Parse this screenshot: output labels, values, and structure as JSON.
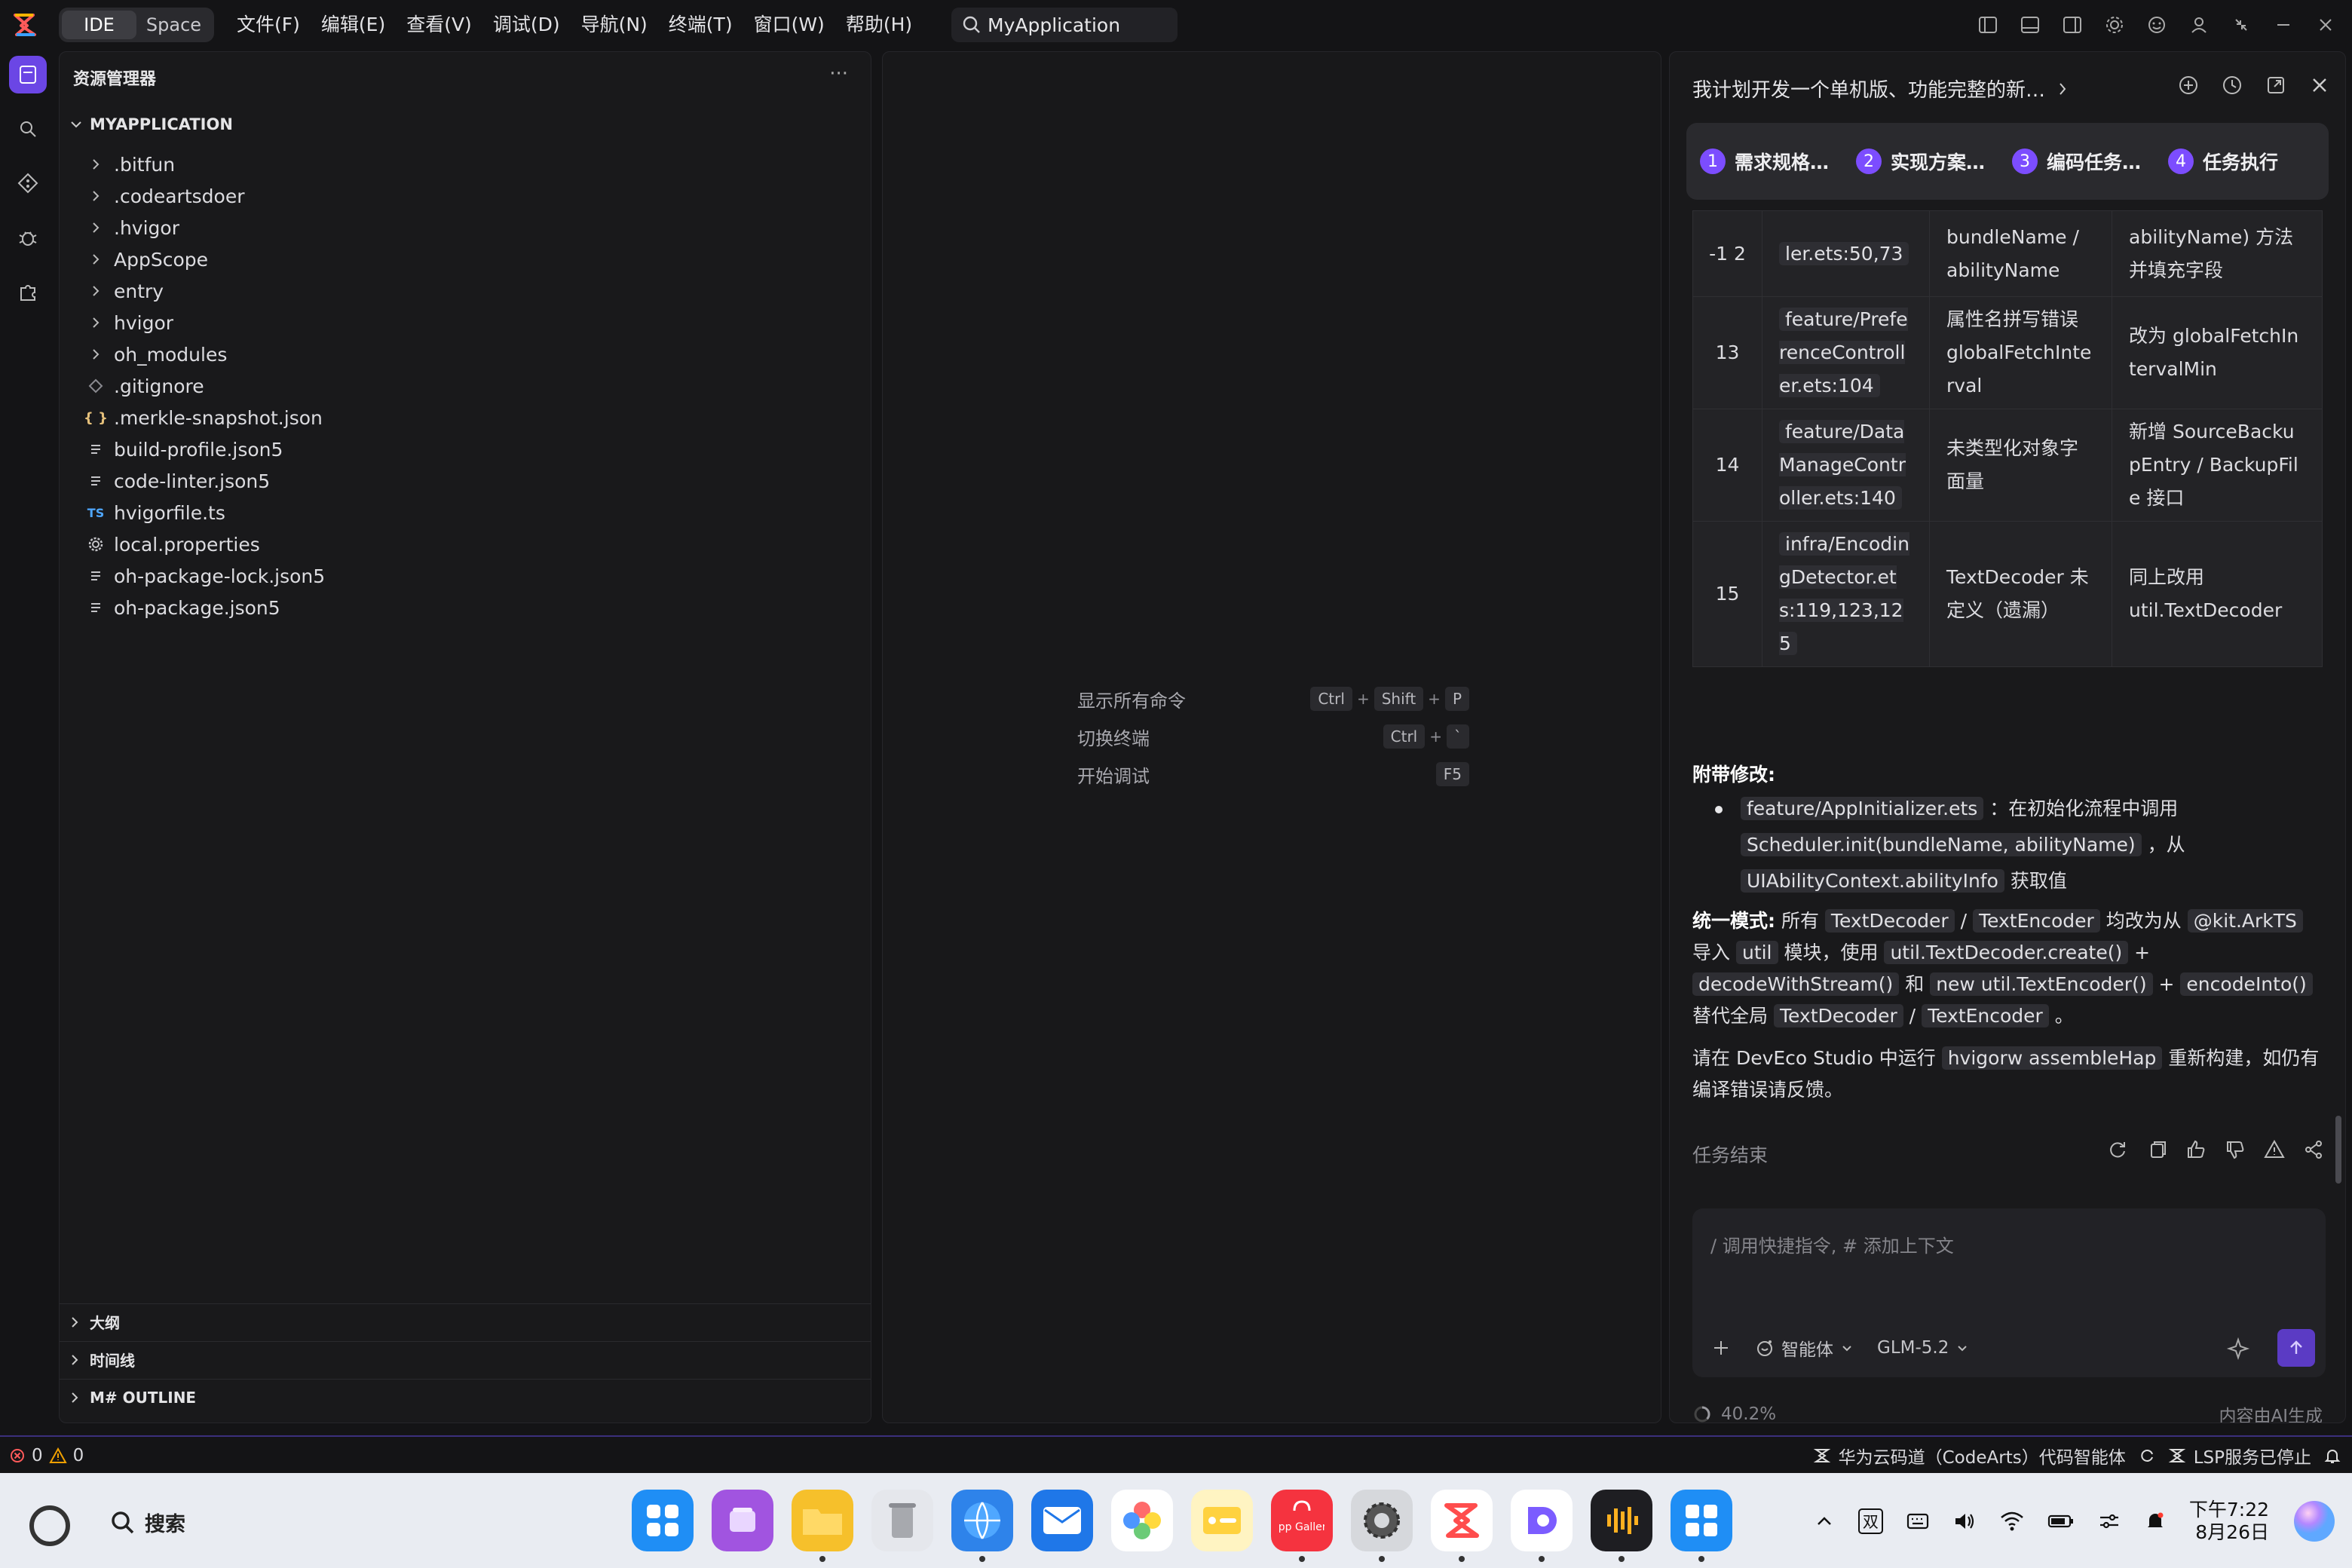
{
  "titlebar": {
    "modes": [
      "IDE",
      "Space"
    ],
    "menu": [
      "文件(F)",
      "编辑(E)",
      "查看(V)",
      "调试(D)",
      "导航(N)",
      "终端(T)",
      "窗口(W)",
      "帮助(H)"
    ],
    "search_value": "MyApplication"
  },
  "explorer": {
    "header": "资源管理器",
    "project": "MYAPPLICATION",
    "items": [
      {
        "label": ".bitfun",
        "type": "folder"
      },
      {
        "label": ".codeartsdoer",
        "type": "folder"
      },
      {
        "label": ".hvigor",
        "type": "folder"
      },
      {
        "label": "AppScope",
        "type": "folder"
      },
      {
        "label": "entry",
        "type": "folder"
      },
      {
        "label": "hvigor",
        "type": "folder"
      },
      {
        "label": "oh_modules",
        "type": "folder"
      },
      {
        "label": ".gitignore",
        "type": "git"
      },
      {
        "label": ".merkle-snapshot.json",
        "type": "json"
      },
      {
        "label": "build-profile.json5",
        "type": "text"
      },
      {
        "label": "code-linter.json5",
        "type": "text"
      },
      {
        "label": "hvigorfile.ts",
        "type": "ts"
      },
      {
        "label": "local.properties",
        "type": "gear"
      },
      {
        "label": "oh-package-lock.json5",
        "type": "text"
      },
      {
        "label": "oh-package.json5",
        "type": "text"
      }
    ],
    "sections": [
      "大纲",
      "时间线",
      "M# OUTLINE"
    ]
  },
  "editor": {
    "commands": [
      {
        "label": "显示所有命令",
        "keys": [
          "Ctrl",
          "Shift",
          "P"
        ]
      },
      {
        "label": "切换终端",
        "keys": [
          "Ctrl",
          "`"
        ]
      },
      {
        "label": "开始调试",
        "keys": [
          "F5"
        ]
      }
    ]
  },
  "ai": {
    "title": "我计划开发一个单机版、功能完整的新…",
    "steps": [
      {
        "num": "1",
        "label": "需求规格…"
      },
      {
        "num": "2",
        "label": "实现方案…"
      },
      {
        "num": "3",
        "label": "编码任务…"
      },
      {
        "num": "4",
        "label": "任务执行"
      }
    ],
    "table_rows": [
      {
        "n": "-1 2",
        "file": "ler.ets:50,73",
        "issue": "bundleName / abilityName",
        "fix": "abilityName) 方法并填充字段"
      },
      {
        "n": "13",
        "file": "feature/PreferenceController.ets:104",
        "issue": "属性名拼写错误 globalFetchInterval",
        "fix": "改为 globalFetchIntervalMin"
      },
      {
        "n": "14",
        "file": "feature/DataManageController.ets:140",
        "issue": "未类型化对象字面量",
        "fix": "新增 SourceBackupEntry / BackupFile 接口"
      },
      {
        "n": "15",
        "file": "infra/EncodingDetector.ets:119,123,125",
        "issue": "TextDecoder 未定义（遗漏）",
        "fix": "同上改用 util.TextDecoder"
      }
    ],
    "extra_heading": "附带修改:",
    "extra_code1": "feature/AppInitializer.ets",
    "extra_text1": "：在初始化流程中调用",
    "extra_code2": "Scheduler.init(bundleName, abilityName)",
    "extra_text2": "，从",
    "extra_code3": "UIAbilityContext.abilityInfo",
    "extra_text3": "获取值",
    "unify_heading": "统一模式:",
    "unify_t1": "所有",
    "unify_c1": "TextDecoder",
    "unify_c2": "TextEncoder",
    "unify_t2": "均改为从",
    "unify_c3": "@kit.ArkTS",
    "unify_t3": "导入",
    "unify_c4": "util",
    "unify_t4": "模块，使用",
    "unify_c5": "util.TextDecoder.create()",
    "unify_c6": "decodeWithStream()",
    "unify_t5": "和",
    "unify_c7": "new util.TextEncoder()",
    "unify_c8": "encodeInto()",
    "unify_t6": "替代全局",
    "unify_c9": "TextDecoder",
    "unify_c10": "TextEncoder",
    "run_t1": "请在 DevEco Studio 中运行",
    "run_code": "hvigorw assembleHap",
    "run_t2": "重新构建，如仍有编译错误请反馈。",
    "task_end": "任务结束",
    "input_placeholder": "/ 调用快捷指令, # 添加上下文",
    "agent_label": "智能体",
    "model_label": "GLM-5.2",
    "progress": "40.2%",
    "ai_notice": "内容由AI生成"
  },
  "status": {
    "errors": "0",
    "warnings": "0",
    "codearts": "华为云码道（CodeArts）代码智能体",
    "lsp": "LSP服务已停止"
  },
  "taskbar": {
    "search": "搜索",
    "ime": "双",
    "time": "下午7:22",
    "date": "8月26日",
    "appgallery_label": "App Gallery"
  },
  "colors": {
    "accent": "#6b46e5",
    "step": "#7c4dff"
  }
}
